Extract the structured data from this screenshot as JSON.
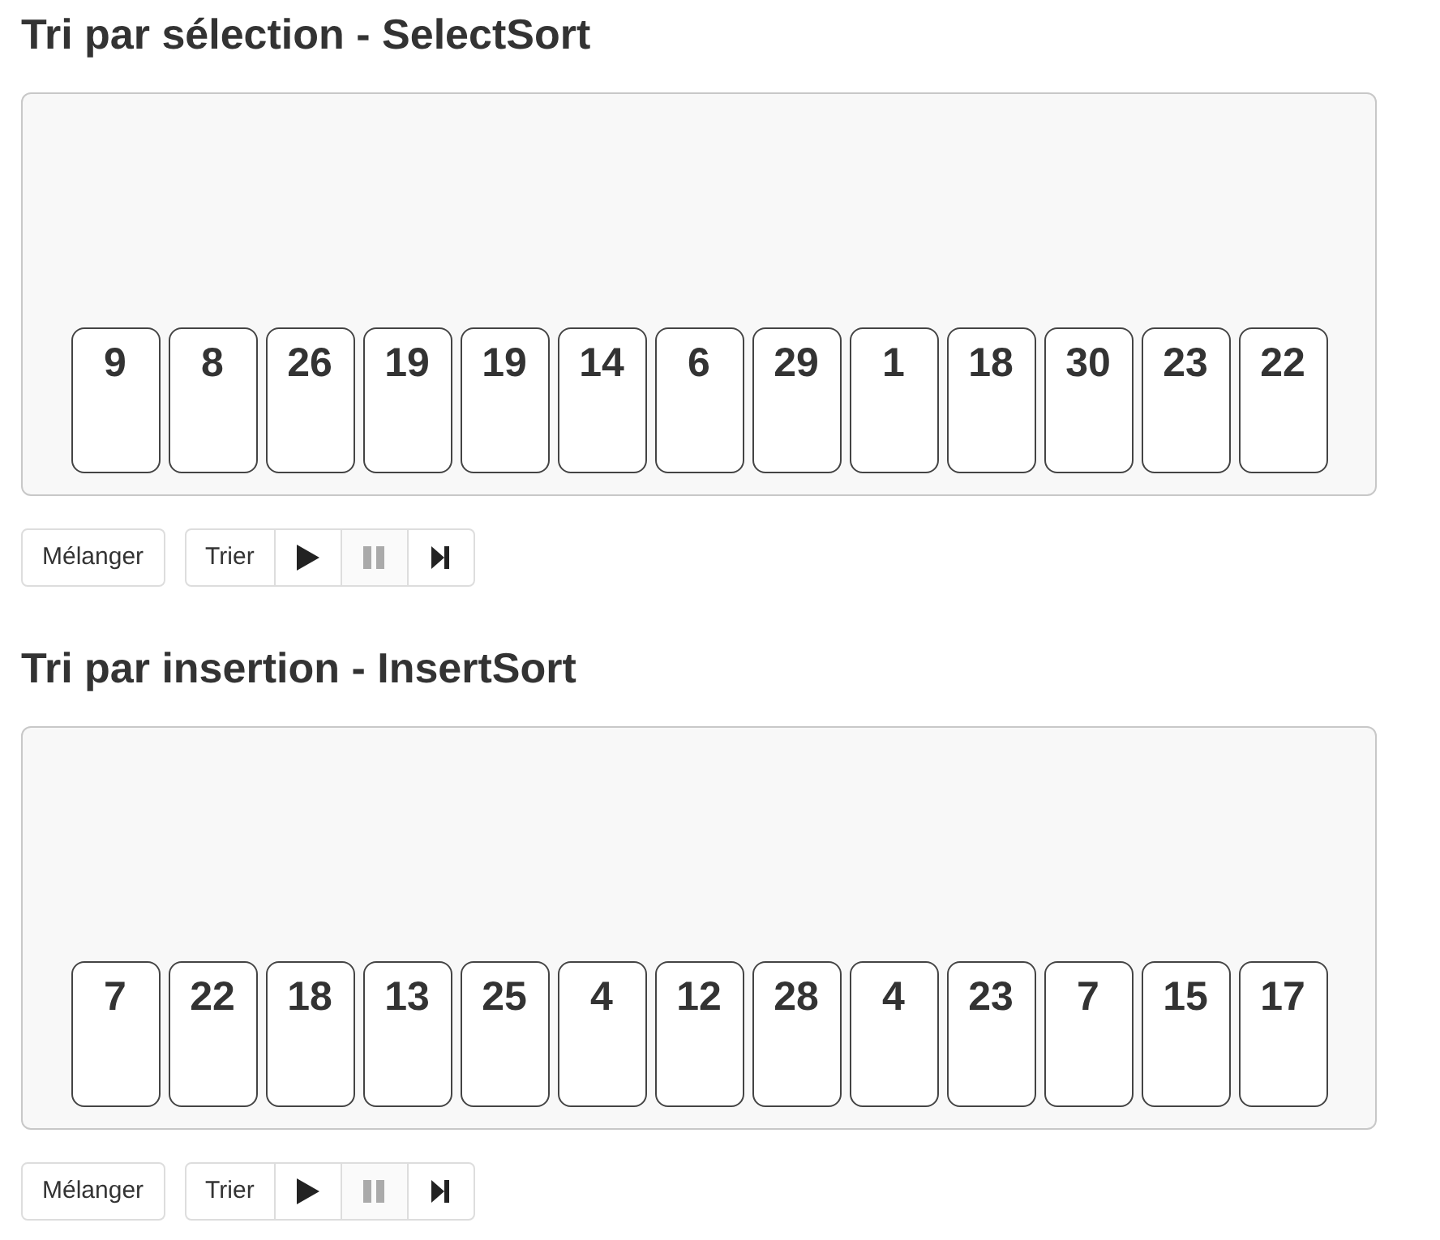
{
  "sections": [
    {
      "title": "Tri par sélection - SelectSort",
      "cards": [
        "9",
        "8",
        "26",
        "19",
        "19",
        "14",
        "6",
        "29",
        "1",
        "18",
        "30",
        "23",
        "22"
      ],
      "shuffle_button": "Mélanger",
      "sort_button": "Trier",
      "controls": [
        {
          "kind": "play",
          "disabled": false
        },
        {
          "kind": "pause",
          "disabled": true
        },
        {
          "kind": "step",
          "disabled": false
        }
      ]
    },
    {
      "title": "Tri par insertion - InsertSort",
      "cards": [
        "7",
        "22",
        "18",
        "13",
        "25",
        "4",
        "12",
        "28",
        "4",
        "23",
        "7",
        "15",
        "17"
      ],
      "shuffle_button": "Mélanger",
      "sort_button": "Trier",
      "controls": [
        {
          "kind": "play",
          "disabled": false
        },
        {
          "kind": "pause",
          "disabled": true
        },
        {
          "kind": "step",
          "disabled": false
        }
      ]
    }
  ]
}
